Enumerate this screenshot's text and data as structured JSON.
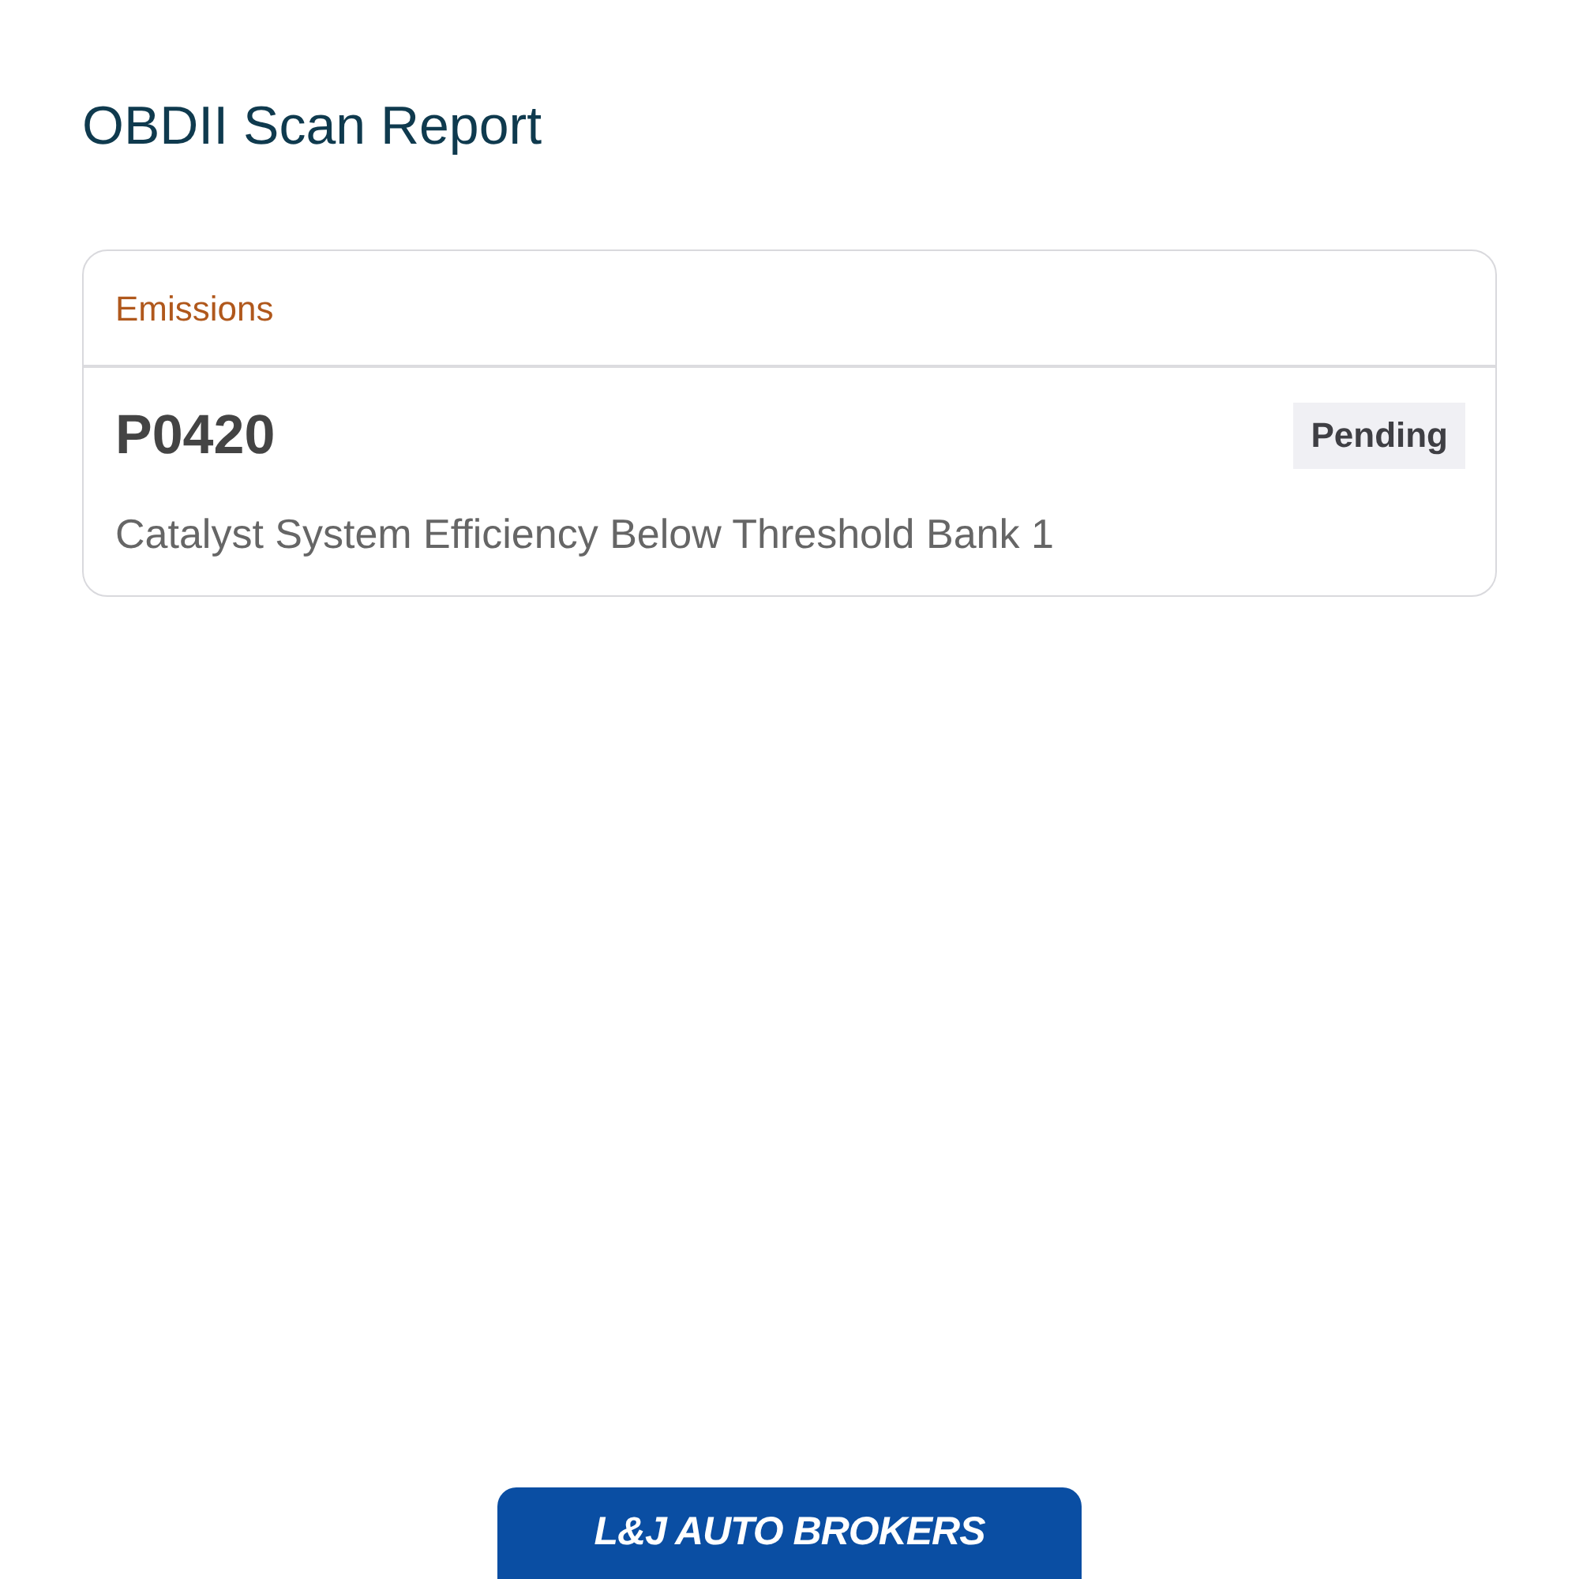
{
  "title": "OBDII Scan Report",
  "codes": [
    {
      "category": "Emissions",
      "code": "P0420",
      "status": "Pending",
      "description": "Catalyst System Efficiency Below Threshold Bank 1"
    }
  ],
  "footer": {
    "brand": "L&J AUTO BROKERS"
  }
}
